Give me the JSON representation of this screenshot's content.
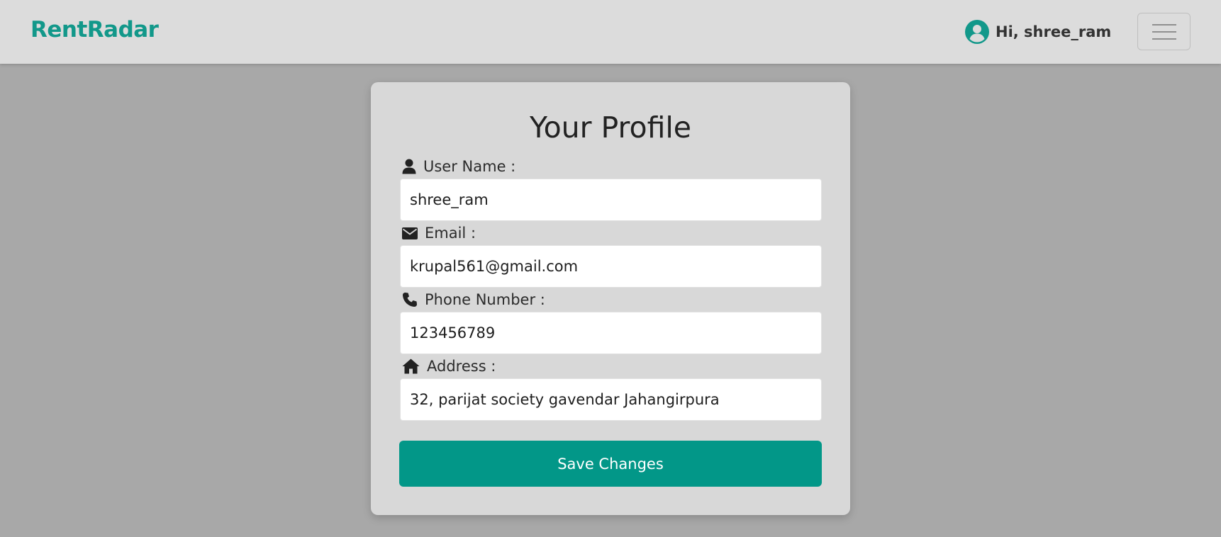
{
  "navbar": {
    "brand": "RentRadar",
    "greeting": "Hi, shree_ram",
    "avatar_icon": "user-circle-icon",
    "menu_icon": "hamburger-menu-icon"
  },
  "profile": {
    "title": "Your Profile",
    "fields": [
      {
        "label": "User Name :",
        "icon": "user-icon",
        "value": "shree_ram"
      },
      {
        "label": "Email :",
        "icon": "envelope-icon",
        "value": "krupal561@gmail.com"
      },
      {
        "label": "Phone Number :",
        "icon": "phone-icon",
        "value": "123456789"
      },
      {
        "label": "Address :",
        "icon": "home-icon",
        "value": "32, parijat society gavendar Jahangirpura"
      }
    ],
    "save_label": "Save Changes"
  },
  "colors": {
    "brand": "#12988a",
    "button": "#029788",
    "overlay_background": "#a8a8a8",
    "card_background": "#d8d8d8"
  }
}
